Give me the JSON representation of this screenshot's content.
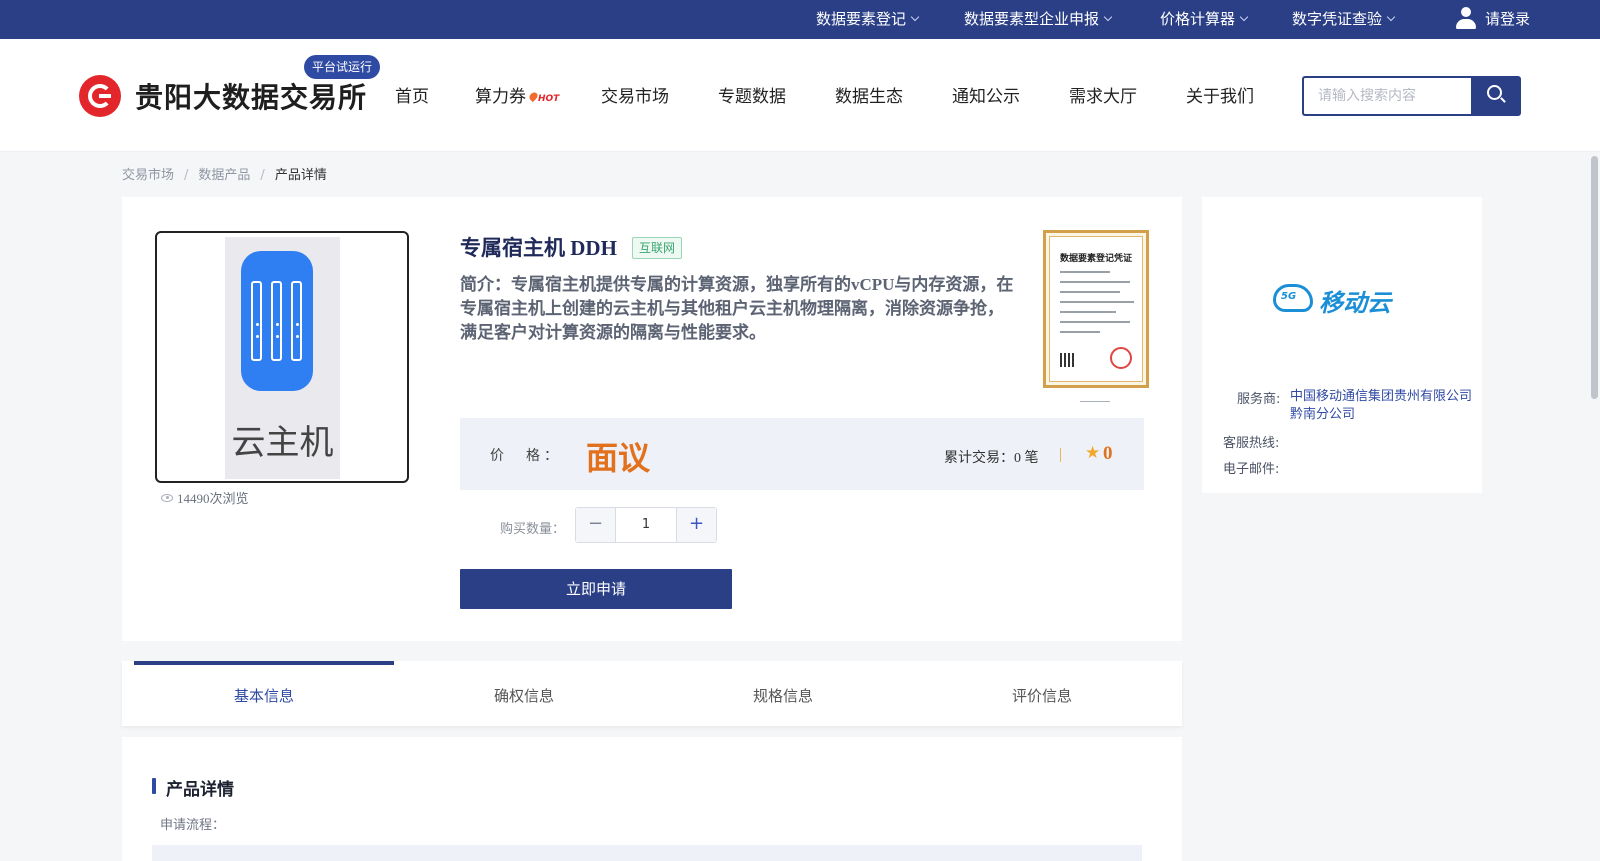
{
  "topbar": {
    "items": [
      {
        "label": "数据要素登记"
      },
      {
        "label": "数据要素型企业申报"
      },
      {
        "label": "价格计算器"
      },
      {
        "label": "数字凭证查验"
      }
    ],
    "login_label": "请登录"
  },
  "header": {
    "brand": "贵阳大数据交易所",
    "trial_badge": "平台试运行",
    "nav": [
      {
        "label": "首页"
      },
      {
        "label": "算力券",
        "hot": "HOT"
      },
      {
        "label": "交易市场"
      },
      {
        "label": "专题数据"
      },
      {
        "label": "数据生态"
      },
      {
        "label": "通知公示"
      },
      {
        "label": "需求大厅"
      },
      {
        "label": "关于我们"
      }
    ],
    "search_placeholder": "请输入搜索内容"
  },
  "breadcrumb": [
    "交易市场",
    "数据产品",
    "产品详情"
  ],
  "breadcrumb_sep": "/",
  "product": {
    "thumbnail_text": "云主机",
    "views": "14490次浏览",
    "title": "专属宿主机 DDH",
    "tag": "互联网",
    "description": "简介：专属宿主机提供专属的计算资源，独享所有的vCPU与内存资源，在专属宿主机上创建的云主机与其他租户云主机物理隔离，消除资源争抢，满足客户对计算资源的隔离与性能要求。",
    "certificate_title": "数据要素登记凭证",
    "price_label": "价　格：",
    "price_value": "面议",
    "trades": "累计交易：0 笔",
    "rating": "0",
    "qty_label": "购买数量：",
    "quantity": "1",
    "minus": "−",
    "plus": "+",
    "apply_label": "立即申请"
  },
  "provider": {
    "logo_text": "移动云",
    "logo_badge": "5G",
    "service_label": "服务商:",
    "service_value": "中国移动通信集团贵州有限公司黔南分公司",
    "hotline_label": "客服热线:",
    "email_label": "电子邮件:"
  },
  "tabs": [
    {
      "label": "基本信息",
      "active": true
    },
    {
      "label": "确权信息"
    },
    {
      "label": "规格信息"
    },
    {
      "label": "评价信息"
    }
  ],
  "details": {
    "section_title": "产品详情",
    "flow_label": "申请流程："
  },
  "colors": {
    "brand_blue": "#2b3f87",
    "accent_orange": "#e2711d",
    "logo_red": "#e3262b"
  }
}
